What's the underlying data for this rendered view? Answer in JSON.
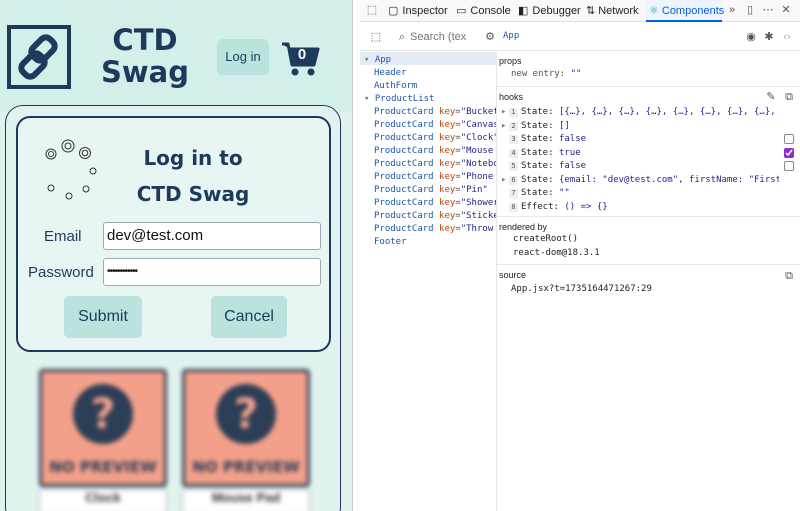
{
  "app": {
    "title": "CTD Swag",
    "header": {
      "login_label": "Log in",
      "cart_count": "0"
    },
    "login_form": {
      "title": "Log in to CTD Swag",
      "email_label": "Email",
      "email_value": "dev@test.com",
      "password_label": "Password",
      "password_value": "••••••••••••",
      "submit_label": "Submit",
      "cancel_label": "Cancel"
    },
    "products": [
      {
        "name": "Clock",
        "image_text": "NO PREVIEW"
      },
      {
        "name": "Mouse Pad",
        "image_text": "NO PREVIEW"
      }
    ]
  },
  "devtools": {
    "tabs": [
      {
        "label": "Inspector",
        "icon": "inspector-icon"
      },
      {
        "label": "Console",
        "icon": "console-icon"
      },
      {
        "label": "Debugger",
        "icon": "debugger-icon"
      },
      {
        "label": "Network",
        "icon": "network-icon"
      },
      {
        "label": "Components",
        "icon": "react-icon",
        "active": true
      }
    ],
    "search_placeholder": "Search (tex",
    "selected_component": "App",
    "tree": [
      {
        "name": "App",
        "depth": 0,
        "expanded": true,
        "selected": true
      },
      {
        "name": "Header",
        "depth": 1
      },
      {
        "name": "AuthForm",
        "depth": 1
      },
      {
        "name": "ProductList",
        "depth": 1,
        "expanded": true
      },
      {
        "name": "ProductCard",
        "key": "Bucket H",
        "depth": 2
      },
      {
        "name": "ProductCard",
        "key": "Canvas B",
        "depth": 2
      },
      {
        "name": "ProductCard",
        "key": "Clock",
        "depth": 2
      },
      {
        "name": "ProductCard",
        "key": "Mouse Pa",
        "depth": 2
      },
      {
        "name": "ProductCard",
        "key": "Notebook",
        "depth": 2
      },
      {
        "name": "ProductCard",
        "key": "Phone Ca",
        "depth": 2
      },
      {
        "name": "ProductCard",
        "key": "Pin",
        "depth": 2
      },
      {
        "name": "ProductCard",
        "key": "Shower C",
        "depth": 2
      },
      {
        "name": "ProductCard",
        "key": "Sticker",
        "depth": 2
      },
      {
        "name": "ProductCard",
        "key": "Throw Pi",
        "depth": 2
      },
      {
        "name": "Footer",
        "depth": 1
      }
    ],
    "props": {
      "title": "props",
      "new_entry_label": "new entry:",
      "new_entry_value": "\"\""
    },
    "hooks": {
      "title": "hooks",
      "items": [
        {
          "index": "1",
          "type": "State:",
          "value": "[{…}, {…}, {…}, {…}, {…}, {…}, {…}, {…}, {…}, {…}]",
          "expandable": true
        },
        {
          "index": "2",
          "type": "State:",
          "value": "[]",
          "expandable": true
        },
        {
          "index": "3",
          "type": "State:",
          "value": "false",
          "checkbox": true,
          "checked": false
        },
        {
          "index": "4",
          "type": "State:",
          "value": "true",
          "checkbox": true,
          "checked": true
        },
        {
          "index": "5",
          "type": "State:",
          "value": "false",
          "checkbox": true,
          "checked": false
        },
        {
          "index": "6",
          "type": "State:",
          "value": "{email: \"dev@test.com\", firstName: \"First\", id: …",
          "expandable": true
        },
        {
          "index": "7",
          "type": "State:",
          "value": "\"\""
        },
        {
          "index": "8",
          "type": "Effect:",
          "value": "() => {}"
        }
      ]
    },
    "rendered_by": {
      "title": "rendered by",
      "items": [
        "createRoot()",
        "react-dom@18.3.1"
      ]
    },
    "source": {
      "title": "source",
      "value": "App.jsx?t=1735164471267:29"
    }
  }
}
